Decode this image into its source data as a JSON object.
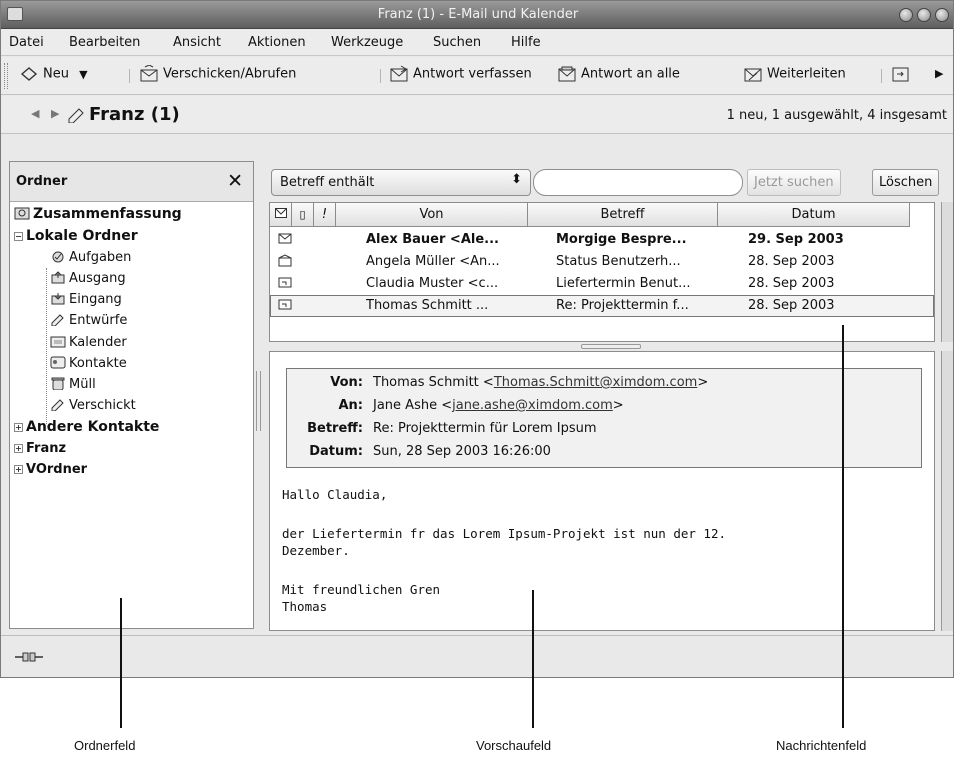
{
  "window": {
    "title": "Franz (1) - E-Mail und Kalender"
  },
  "menu": [
    "Datei",
    "Bearbeiten",
    "Ansicht",
    "Aktionen",
    "Werkzeuge",
    "Suchen",
    "Hilfe"
  ],
  "toolbar": {
    "new_label": "Neu",
    "send_receive_label": "Verschicken/Abrufen",
    "reply_label": "Antwort verfassen",
    "reply_all_label": "Antwort an alle",
    "forward_label": "Weiterleiten"
  },
  "location": {
    "folder": "Franz (1)",
    "status": "1 neu, 1 ausgewählt, 4 insgesamt"
  },
  "folder_pane": {
    "header": "Ordner",
    "close_glyph": "✕",
    "items": [
      {
        "label": "Zusammenfassung"
      },
      {
        "label": "Lokale Ordner"
      },
      {
        "label": "Aufgaben"
      },
      {
        "label": "Ausgang"
      },
      {
        "label": "Eingang"
      },
      {
        "label": "Entwürfe"
      },
      {
        "label": "Kalender"
      },
      {
        "label": "Kontakte"
      },
      {
        "label": "Müll"
      },
      {
        "label": "Verschickt"
      },
      {
        "label": "Andere Kontakte"
      },
      {
        "label": "Franz"
      },
      {
        "label": "VOrdner"
      }
    ]
  },
  "search": {
    "criteria": "Betreff enthält",
    "query": "",
    "search_button": "Jetzt suchen",
    "clear_button": "Löschen"
  },
  "message_list": {
    "columns": [
      "Von",
      "Betreff",
      "Datum"
    ],
    "flag_column": "!",
    "rows": [
      {
        "from": "Alex Bauer <Ale...",
        "subject": "Morgige Bespre...",
        "date": "29. Sep 2003"
      },
      {
        "from": "Angela Müller <An...",
        "subject": "Status Benutzerh...",
        "date": "28. Sep 2003"
      },
      {
        "from": "Claudia Muster <c...",
        "subject": "Liefertermin Benut...",
        "date": "28. Sep 2003"
      },
      {
        "from": "Thomas Schmitt ...",
        "subject": "Re: Projekttermin f...",
        "date": "28. Sep 2003"
      }
    ]
  },
  "preview": {
    "from_label": "Von:",
    "from_name": "Thomas Schmitt <",
    "from_email": "Thomas.Schmitt@ximdom.com",
    "from_close": ">",
    "to_label": "An:",
    "to_name": "Jane Ashe <",
    "to_email": "jane.ashe@ximdom.com",
    "to_close": ">",
    "subject_label": "Betreff:",
    "subject": "Re: Projekttermin für Lorem Ipsum",
    "date_label": "Datum:",
    "date": "Sun, 28 Sep 2003 16:26:00",
    "body": [
      "Hallo Claudia,",
      "der Liefertermin fr das Lorem Ipsum-Projekt ist nun der 12.",
      "Dezember.",
      "Mit freundlichen Gren",
      "Thomas"
    ]
  },
  "callouts": {
    "folder_pane": "Ordnerfeld",
    "preview_pane": "Vorschaufeld",
    "message_list": "Nachrichtenfeld"
  }
}
